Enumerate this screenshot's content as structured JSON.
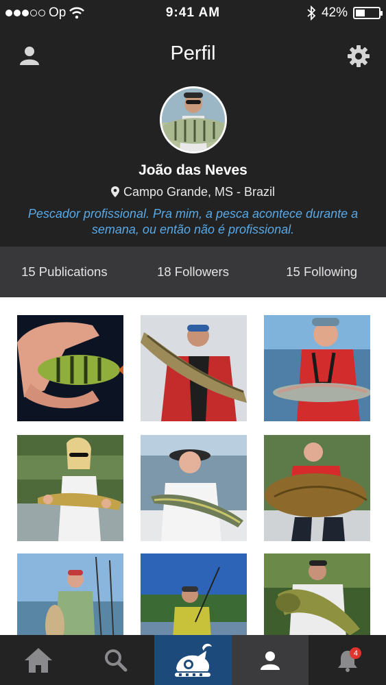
{
  "status_bar": {
    "carrier": "Op",
    "time": "9:41 AM",
    "battery": "42%",
    "battery_level": 0.42
  },
  "header": {
    "title": "Perfil",
    "left_icon": "user-icon",
    "right_icon": "gear-icon"
  },
  "profile": {
    "name": "João das Neves",
    "location": "Campo Grande, MS - Brazil",
    "bio": "Pescador profissional. Pra mim, a pesca acontece durante a semana, ou então não é profissional."
  },
  "stats": {
    "publications": "15 Publications",
    "followers": "18 Followers",
    "following": "15 Following"
  },
  "photos": [
    {
      "scene": "perch-in-hand"
    },
    {
      "scene": "pike-angler"
    },
    {
      "scene": "trout-angler"
    },
    {
      "scene": "woman-with-fish"
    },
    {
      "scene": "boat-angler"
    },
    {
      "scene": "carp-angler"
    },
    {
      "scene": "sea-angler"
    },
    {
      "scene": "lake-angler"
    },
    {
      "scene": "bass-angler"
    }
  ],
  "tabbar": {
    "items": [
      "home-icon",
      "search-icon",
      "fish-logo-icon",
      "profile-icon",
      "bell-icon"
    ],
    "notification_count": "4"
  },
  "colors": {
    "header_bg": "#222223",
    "stats_bg": "#38383a",
    "bio_text": "#58a9e6",
    "active_center_tab": "#1c4a7a",
    "badge": "#e0352f"
  }
}
